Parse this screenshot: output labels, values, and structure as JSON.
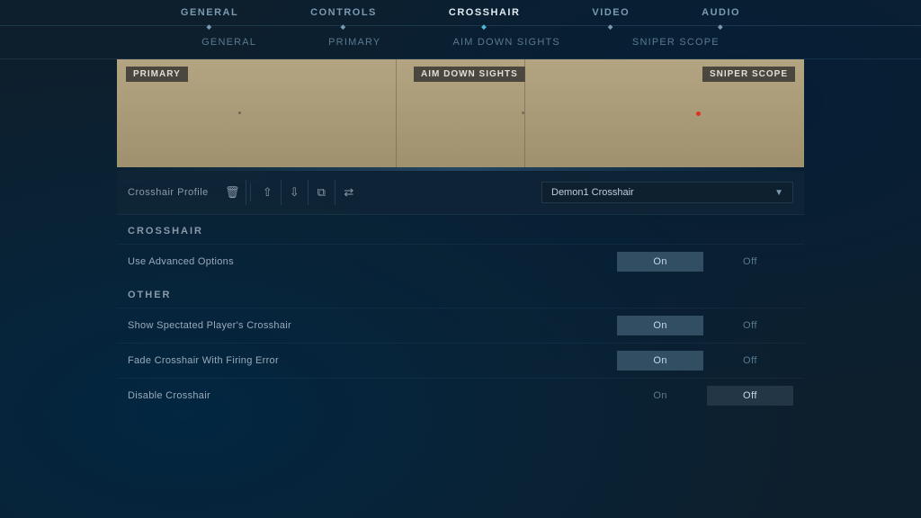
{
  "topNav": {
    "items": [
      {
        "label": "GENERAL",
        "active": false
      },
      {
        "label": "CONTROLS",
        "active": false
      },
      {
        "label": "CROSSHAIR",
        "active": true
      },
      {
        "label": "VIDEO",
        "active": false
      },
      {
        "label": "AUDIO",
        "active": false
      }
    ]
  },
  "subNav": {
    "items": [
      {
        "label": "GENERAL",
        "active": false
      },
      {
        "label": "PRIMARY",
        "active": false
      },
      {
        "label": "AIM DOWN SIGHTS",
        "active": false
      },
      {
        "label": "SNIPER SCOPE",
        "active": false
      }
    ]
  },
  "preview": {
    "primaryLabel": "PRIMARY",
    "adsLabel": "AIM DOWN SIGHTS",
    "sniperLabel": "SNIPER SCOPE"
  },
  "profile": {
    "label": "Crosshair Profile",
    "dropdownValue": "Demon1 Crosshair",
    "icons": [
      {
        "name": "delete-icon",
        "symbol": "🗑"
      },
      {
        "name": "upload-icon",
        "symbol": "⬆"
      },
      {
        "name": "download-icon",
        "symbol": "⬇"
      },
      {
        "name": "copy-icon",
        "symbol": "⧉"
      },
      {
        "name": "settings-icon",
        "symbol": "≡"
      }
    ]
  },
  "crosshairSection": {
    "header": "CROSSHAIR",
    "rows": [
      {
        "label": "Use Advanced Options",
        "onState": "on",
        "onLabel": "On",
        "offLabel": "Off"
      }
    ]
  },
  "otherSection": {
    "header": "OTHER",
    "rows": [
      {
        "label": "Show Spectated Player's Crosshair",
        "onState": "on",
        "onLabel": "On",
        "offLabel": "Off"
      },
      {
        "label": "Fade Crosshair With Firing Error",
        "onState": "on",
        "onLabel": "On",
        "offLabel": "Off"
      },
      {
        "label": "Disable Crosshair",
        "onState": "off",
        "onLabel": "On",
        "offLabel": "Off"
      }
    ]
  }
}
